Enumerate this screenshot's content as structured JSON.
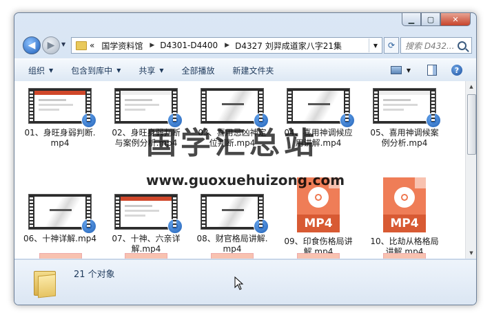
{
  "window": {
    "min_icon": "minimize-icon",
    "max_icon": "maximize-icon",
    "close_icon": "close-icon"
  },
  "address_bar": {
    "overflow": "«",
    "crumbs": [
      "国学资料馆",
      "D4301-D4400",
      "D4327 刘羿成道家八字21集"
    ],
    "search_placeholder": "搜索 D432..."
  },
  "toolbar": {
    "organize": "组织",
    "include_in_library": "包含到库中",
    "share": "共享",
    "play_all": "全部播放",
    "new_folder": "新建文件夹"
  },
  "files": [
    {
      "label": "01、身旺身弱判断.mp4",
      "thumb": "video"
    },
    {
      "label": "02、身旺身弱判断与案例分析.mp4",
      "thumb": "video"
    },
    {
      "label": "03、喜用忌凶神定位判断.mp4",
      "thumb": "ink"
    },
    {
      "label": "04、喜用神调候应用讲解.mp4",
      "thumb": "ink"
    },
    {
      "label": "05、喜用神调候案例分析.mp4",
      "thumb": "video"
    },
    {
      "label": "06、十神详解.mp4",
      "thumb": "ink"
    },
    {
      "label": "07、十神、六亲详解.mp4",
      "thumb": "video"
    },
    {
      "label": "08、财官格局讲解.mp4",
      "thumb": "ink"
    },
    {
      "label": "09、印食伤格局讲解.mp4",
      "thumb": "mp4"
    },
    {
      "label": "10、比劫从格格局讲解.mp4",
      "thumb": "mp4"
    }
  ],
  "mp4_text": "MP4",
  "watermark": {
    "title": "国学汇总站",
    "url": "www.guoxuehuizong.com"
  },
  "details": {
    "count": "21 个对象"
  }
}
